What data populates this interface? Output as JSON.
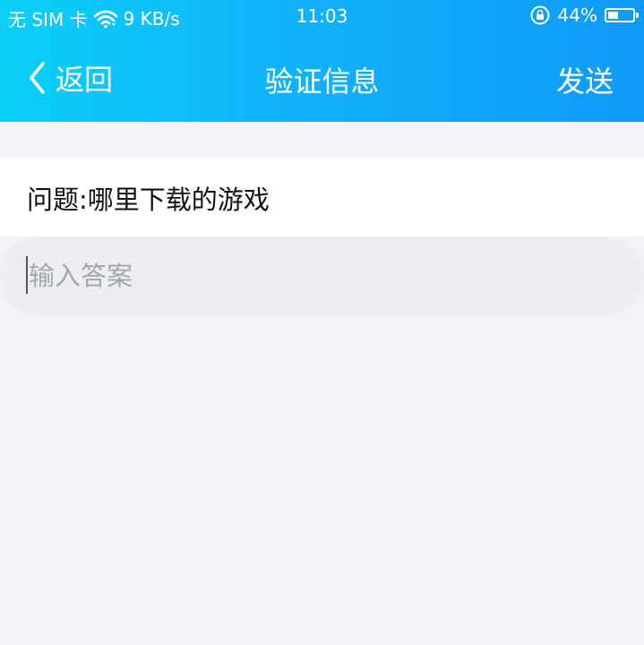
{
  "status_bar": {
    "carrier": "无 SIM 卡",
    "network_speed": "9 KB/s",
    "time": "11:03",
    "battery_percent": "44%",
    "battery_level": 0.44,
    "icons": [
      "wifi-icon",
      "rotation-lock-icon",
      "battery-icon"
    ]
  },
  "nav": {
    "back_label": "返回",
    "title": "验证信息",
    "send_label": "发送"
  },
  "form": {
    "question": "问题:哪里下载的游戏",
    "answer_placeholder": "输入答案",
    "answer_value": ""
  },
  "colors": {
    "header_gradient_start": "#0ad0f8",
    "header_gradient_end": "#0f9af8",
    "page_background": "#f2f3f7"
  }
}
